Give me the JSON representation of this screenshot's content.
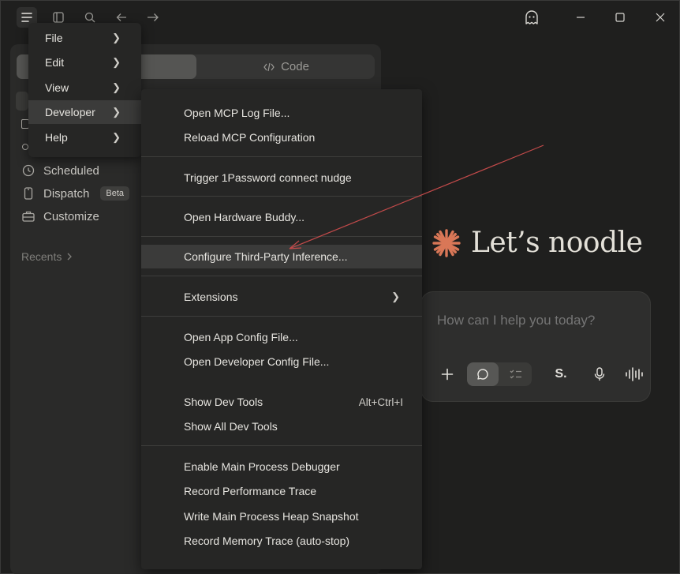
{
  "titlebar": {
    "icons": [
      "hamburger-icon",
      "sidebar-toggle-icon",
      "search-icon",
      "back-icon",
      "forward-icon",
      "ghost-icon",
      "minimize-icon",
      "maximize-icon",
      "close-icon"
    ]
  },
  "mode_switch": {
    "code_label": "Code"
  },
  "nav": {
    "items": [
      {
        "label": "Scheduled",
        "icon": "clock-icon"
      },
      {
        "label": "Dispatch",
        "icon": "phone-icon",
        "badge": "Beta"
      },
      {
        "label": "Customize",
        "icon": "briefcase-icon"
      }
    ],
    "recents_label": "Recents"
  },
  "main": {
    "greeting": "Let’s noodle",
    "composer_placeholder": "How can I help you today?",
    "style_button_label": "S."
  },
  "menu": {
    "items": [
      {
        "label": "File"
      },
      {
        "label": "Edit"
      },
      {
        "label": "View"
      },
      {
        "label": "Developer"
      },
      {
        "label": "Help"
      }
    ]
  },
  "developer_submenu": {
    "items": [
      {
        "label": "Open MCP Log File..."
      },
      {
        "label": "Reload MCP Configuration"
      },
      {
        "label": "Trigger 1Password connect nudge"
      },
      {
        "label": "Open Hardware Buddy..."
      },
      {
        "label": "Configure Third-Party Inference..."
      },
      {
        "label": "Extensions"
      },
      {
        "label": "Open App Config File..."
      },
      {
        "label": "Open Developer Config File..."
      },
      {
        "label": "Show Dev Tools",
        "accelerator": "Alt+Ctrl+I"
      },
      {
        "label": "Show All Dev Tools"
      },
      {
        "label": "Enable Main Process Debugger"
      },
      {
        "label": "Record Performance Trace"
      },
      {
        "label": "Write Main Process Heap Snapshot"
      },
      {
        "label": "Record Memory Trace (auto-stop)"
      }
    ]
  },
  "colors": {
    "accent": "#d97757",
    "annotation_arrow": "#c24a4a",
    "background": "#1f1f1e",
    "menu_bg": "#262625"
  }
}
